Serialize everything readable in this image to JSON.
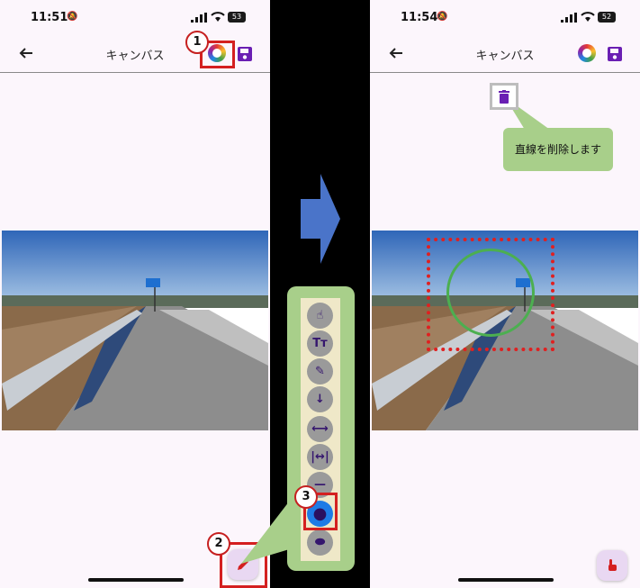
{
  "left_screen": {
    "status": {
      "time": "11:51",
      "battery": "53"
    },
    "appbar": {
      "title": "キャンバス"
    }
  },
  "right_screen": {
    "status": {
      "time": "11:54",
      "battery": "52"
    },
    "appbar": {
      "title": "キャンバス"
    },
    "tooltip": "直線を削除します"
  },
  "badges": [
    "1",
    "2",
    "3"
  ],
  "toolbar": {
    "buttons": [
      {
        "name": "hand-tool-icon",
        "glyph": "☝"
      },
      {
        "name": "text-tool-icon",
        "glyph": "Tт"
      },
      {
        "name": "pen-tool-icon",
        "glyph": "✎"
      },
      {
        "name": "arrow-tool-icon",
        "glyph": "↓"
      },
      {
        "name": "double-arrow-tool-icon",
        "glyph": "⟷"
      },
      {
        "name": "dimension-tool-icon",
        "glyph": "|↔|"
      },
      {
        "name": "line-tool-icon",
        "glyph": "—"
      },
      {
        "name": "circle-tool-icon",
        "glyph": "●"
      },
      {
        "name": "ellipse-tool-icon",
        "glyph": "⬬"
      }
    ],
    "selected": "circle-tool-icon"
  },
  "colors": {
    "accent": "#6a1fb3",
    "highlight": "#d42020",
    "callout": "#a8cf8a",
    "arrow": "#4a74c9",
    "circle": "#4caf50"
  }
}
